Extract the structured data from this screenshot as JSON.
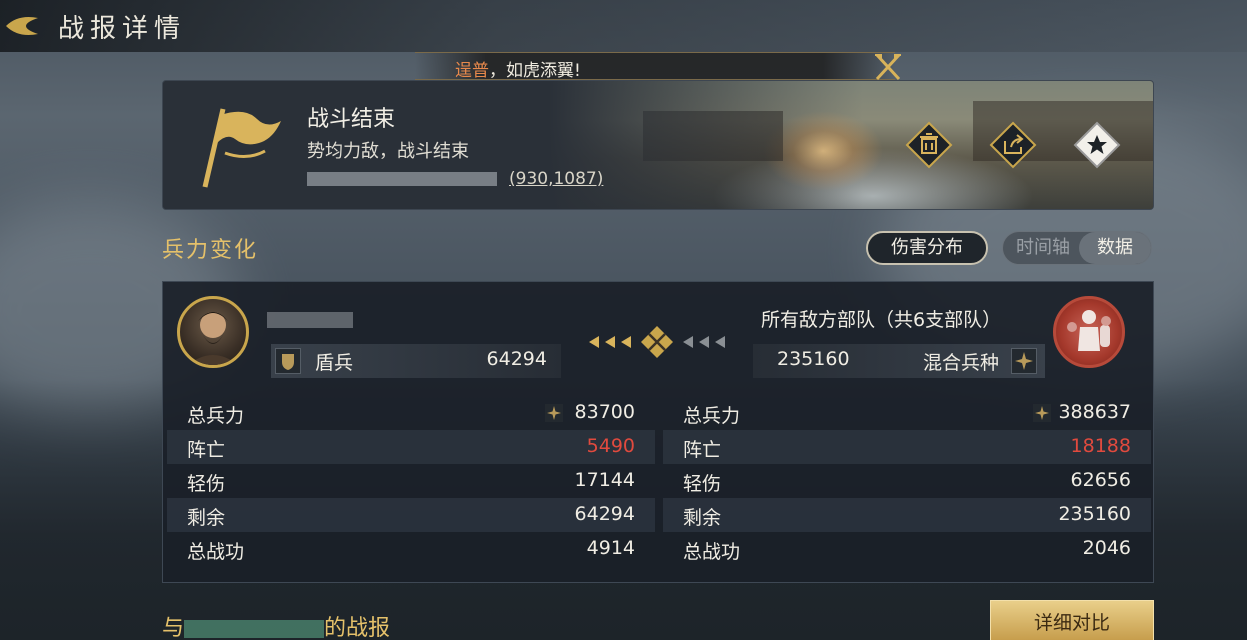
{
  "header": {
    "title": "战报详情"
  },
  "banner": {
    "name": "逞普",
    "text": "，如虎添翼!"
  },
  "battle": {
    "title": "战斗结束",
    "subtitle": "势均力敌，战斗结束",
    "coords": "(930,1087)"
  },
  "section": {
    "title": "兵力变化",
    "damage_button": "伤害分布",
    "toggle": {
      "option_a": "时间轴",
      "option_b": "数据",
      "selected": "数据"
    }
  },
  "left": {
    "unit_type": "盾兵",
    "unit_count": "64294",
    "stats": [
      {
        "label": "总兵力",
        "value": "83700"
      },
      {
        "label": "阵亡",
        "value": "5490"
      },
      {
        "label": "轻伤",
        "value": "17144"
      },
      {
        "label": "剩余",
        "value": "64294"
      },
      {
        "label": "总战功",
        "value": "4914"
      }
    ]
  },
  "right": {
    "title": "所有敌方部队（共6支部队）",
    "unit_type": "混合兵种",
    "unit_count": "235160",
    "stats": [
      {
        "label": "总兵力",
        "value": "388637"
      },
      {
        "label": "阵亡",
        "value": "18188"
      },
      {
        "label": "轻伤",
        "value": "62656"
      },
      {
        "label": "剩余",
        "value": "235160"
      },
      {
        "label": "总战功",
        "value": "2046"
      }
    ]
  },
  "bottom": {
    "prefix": "与",
    "suffix": "的战报",
    "detail_button": "详细对比"
  },
  "colors": {
    "gold": "#e5c16a",
    "loss_red": "#e14a3e",
    "enemy_red": "#b74a3a"
  }
}
